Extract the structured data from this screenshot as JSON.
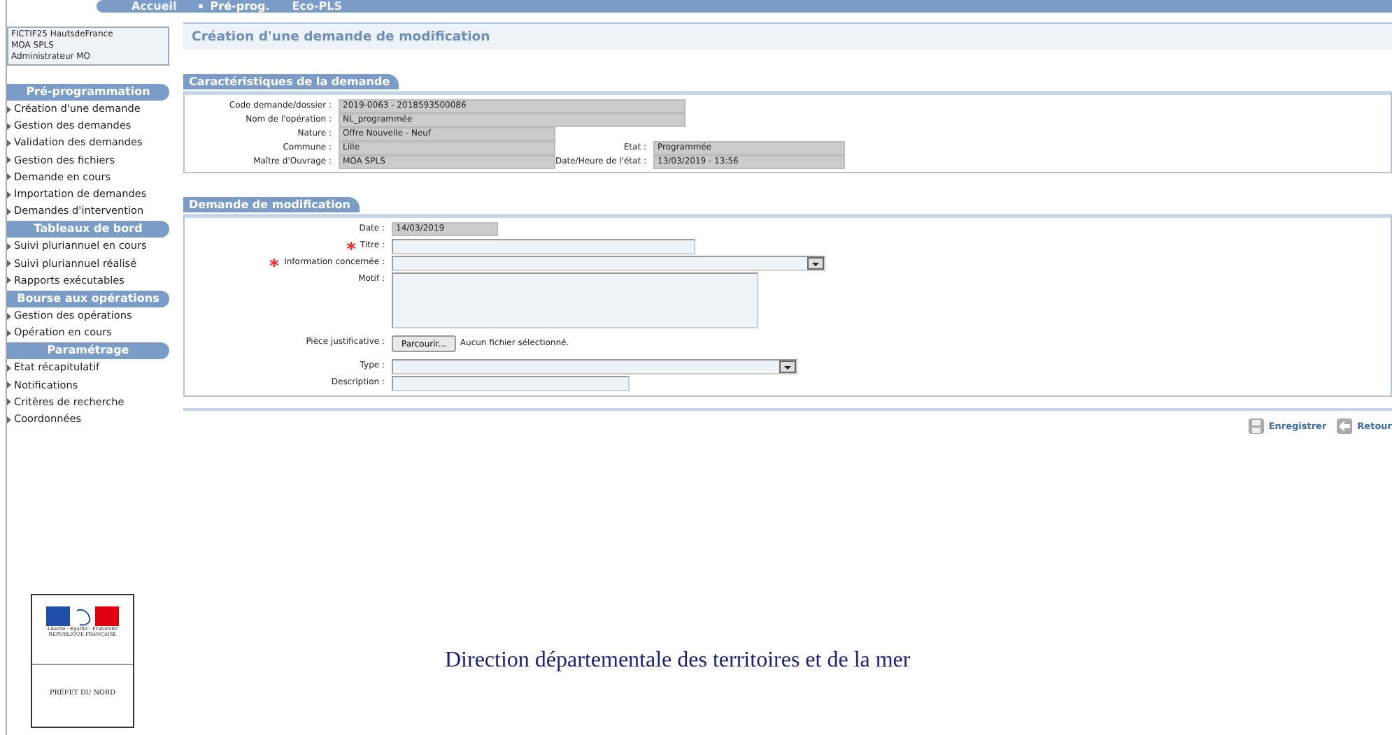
{
  "nav": [
    {
      "label": "Accueil",
      "selected": false
    },
    {
      "label": "Pré-prog.",
      "selected": true
    },
    {
      "label": "Eco-PLS",
      "selected": false
    }
  ],
  "user_info": [
    "FICTIF25 HautsdeFrance",
    "MOA SPLS",
    "Administrateur MO"
  ],
  "sidebar": [
    {
      "title": "Pré-programmation",
      "items": [
        "Création d'une demande",
        "Gestion des demandes",
        "Validation des demandes",
        "Gestion des fichiers",
        "Demande en cours",
        "Importation de demandes",
        "Demandes d'intervention"
      ]
    },
    {
      "title": "Tableaux de bord",
      "items": [
        "Suivi pluriannuel en cours",
        "Suivi pluriannuel réalisé",
        "Rapports exécutables"
      ]
    },
    {
      "title": "Bourse aux opérations",
      "items": [
        "Gestion des opérations",
        "Opération en cours"
      ]
    },
    {
      "title": "Paramétrage",
      "items": [
        "Etat récapitulatif",
        "Notifications",
        "Critères de recherche",
        "Coordonnées"
      ]
    }
  ],
  "page_title": "Création d'une demande de modification",
  "characteristics": {
    "title": "Caractéristiques de la demande",
    "rows": [
      [
        {
          "label": "Code demande/dossier :",
          "value": "2019-0063 - 2018593500086",
          "kind": "long"
        }
      ],
      [
        {
          "label": "Nom de l'opération :",
          "value": "NL_programmée",
          "kind": "long"
        }
      ],
      [
        {
          "label": "Nature :",
          "value": "Offre Nouvelle - Neuf",
          "kind": "short"
        }
      ],
      [
        {
          "label": "Commune :",
          "value": "Lille",
          "kind": "short"
        },
        {
          "label": "Etat :",
          "value": "Programmée",
          "kind": "short"
        }
      ],
      [
        {
          "label": "Maître d'Ouvrage :",
          "value": "MOA SPLS",
          "kind": "short"
        },
        {
          "label": "Date/Heure de l'état :",
          "value": "13/03/2019 - 13:56",
          "kind": "short"
        }
      ]
    ]
  },
  "modification": {
    "title": "Demande de modification",
    "fields": [
      {
        "label": "Date :",
        "kind": "readonly",
        "value": "14/03/2019",
        "required": false
      },
      {
        "label": "Titre :",
        "kind": "text",
        "required": true
      },
      {
        "label": "Information concernée :",
        "kind": "select",
        "required": true
      },
      {
        "label": "Motif :",
        "kind": "textarea",
        "required": false
      },
      {
        "label": "Pièce justificative :",
        "kind": "file",
        "button": "Parcourir...",
        "note": "Aucun fichier sélectionné.",
        "required": false
      },
      {
        "label": "Type :",
        "kind": "select",
        "required": false
      },
      {
        "label": "Description :",
        "kind": "text",
        "required": false
      }
    ]
  },
  "actions": [
    {
      "label": "Enregistrer",
      "kind": "save"
    },
    {
      "label": "Retour",
      "kind": "back"
    }
  ],
  "logo": {
    "motto": "Liberté · Égalité · Fraternité",
    "republic": "RÉPUBLIQUE FRANÇAISE",
    "prefect": "PRÉFET DU NORD"
  },
  "footer": "Direction départementale des territoires et de la mer"
}
